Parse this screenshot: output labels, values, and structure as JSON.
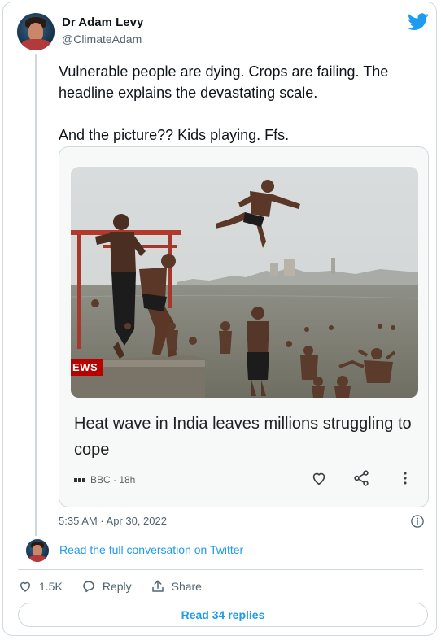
{
  "author": {
    "name": "Dr Adam Levy",
    "handle": "@ClimateAdam",
    "avatar_icon": "profile-avatar"
  },
  "brand_icon": "twitter-bird-icon",
  "colors": {
    "twitter_blue": "#1d9bf0",
    "bbc_red": "#b80000",
    "border": "#cfd9de",
    "muted": "#536471"
  },
  "tweet": {
    "lines": [
      "Vulnerable people are dying. Crops are failing. The headline explains the devastating scale.",
      "And the picture?? Kids playing. Ffs."
    ],
    "timestamp": "5:35 AM · Apr 30, 2022"
  },
  "card": {
    "news_tag": "EWS",
    "headline": "Heat wave in India leaves millions struggling to cope",
    "source": "BBC · 18h",
    "icons": [
      "heart-icon",
      "share-icon",
      "more-vertical-icon"
    ]
  },
  "footer": {
    "read_full_label": "Read the full conversation on Twitter",
    "likes_count": "1.5K",
    "reply_label": "Reply",
    "share_label": "Share",
    "read_replies_label": "Read 34 replies"
  }
}
